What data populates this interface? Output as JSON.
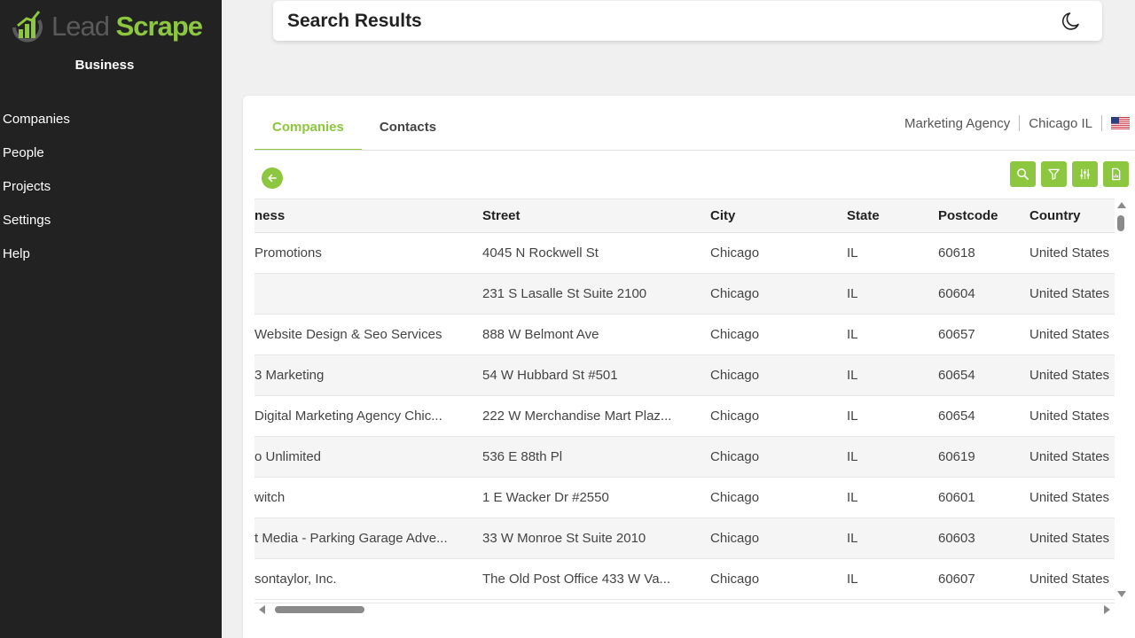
{
  "app": {
    "logo_lead": "Lead",
    "logo_scrape": "Scrape",
    "edition": "Business"
  },
  "sidebar": {
    "items": [
      {
        "label": "Companies"
      },
      {
        "label": "People"
      },
      {
        "label": "Projects"
      },
      {
        "label": "Settings"
      },
      {
        "label": "Help"
      }
    ]
  },
  "header": {
    "title": "Search Results",
    "theme_toggle_icon": "moon-icon"
  },
  "tabs": [
    {
      "label": "Companies",
      "active": true
    },
    {
      "label": "Contacts",
      "active": false
    }
  ],
  "search_criteria": {
    "keyword": "Marketing Agency",
    "location": "Chicago IL",
    "country_flag_icon": "us-flag-icon"
  },
  "toolbar": {
    "back_icon": "arrow-left-icon",
    "buttons": [
      "search-icon",
      "filter-icon",
      "columns-icon",
      "export-icon"
    ]
  },
  "table": {
    "columns": [
      "ness",
      "Street",
      "City",
      "State",
      "Postcode",
      "Country"
    ],
    "rows": [
      {
        "business": " Promotions",
        "street": "4045 N Rockwell St",
        "city": "Chicago",
        "state": "IL",
        "postcode": "60618",
        "country": "United States"
      },
      {
        "business": "",
        "street": "231 S Lasalle St Suite 2100",
        "city": "Chicago",
        "state": "IL",
        "postcode": "60604",
        "country": "United States"
      },
      {
        "business": " Website Design & Seo Services",
        "street": "888 W Belmont Ave",
        "city": "Chicago",
        "state": "IL",
        "postcode": "60657",
        "country": "United States"
      },
      {
        "business": "3 Marketing",
        "street": "54 W Hubbard St #501",
        "city": "Chicago",
        "state": "IL",
        "postcode": "60654",
        "country": "United States"
      },
      {
        "business": " Digital Marketing Agency Chic...",
        "street": "222 W Merchandise Mart Plaz...",
        "city": "Chicago",
        "state": "IL",
        "postcode": "60654",
        "country": "United States"
      },
      {
        "business": "o Unlimited",
        "street": "536 E 88th Pl",
        "city": "Chicago",
        "state": "IL",
        "postcode": "60619",
        "country": "United States"
      },
      {
        "business": "witch",
        "street": "1 E Wacker Dr #2550",
        "city": "Chicago",
        "state": "IL",
        "postcode": "60601",
        "country": "United States"
      },
      {
        "business": "t Media - Parking Garage Adve...",
        "street": "33 W Monroe St Suite 2010",
        "city": "Chicago",
        "state": "IL",
        "postcode": "60603",
        "country": "United States"
      },
      {
        "business": "sontaylor, Inc.",
        "street": "The Old Post Office 433 W Va...",
        "city": "Chicago",
        "state": "IL",
        "postcode": "60607",
        "country": "United States"
      }
    ]
  },
  "colors": {
    "accent": "#8dc63f",
    "sidebar_bg": "#222222",
    "page_bg": "#f0f0f0"
  }
}
